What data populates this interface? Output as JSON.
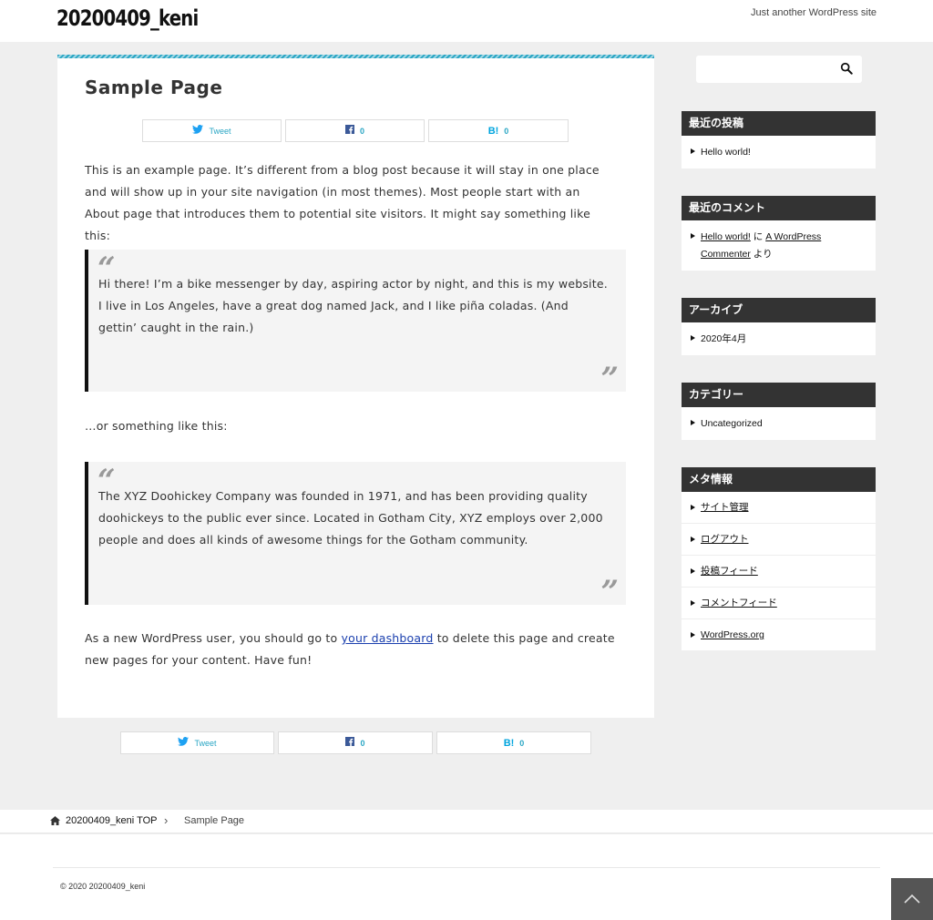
{
  "header": {
    "site_title": "20200409_keni",
    "tagline": "Just another WordPress site"
  },
  "main": {
    "page_title": "Sample Page",
    "share_top": {
      "tweet": "Tweet",
      "facebook_count": "0",
      "hatena_count": "0"
    },
    "intro": "This is an example page. It’s different from a blog post because it will stay in one place and will show up in your site navigation (in most themes). Most people start with an About page that introduces them to potential site visitors. It might say something like this:",
    "quote1": "Hi there! I’m a bike messenger by day, aspiring actor by night, and this is my website. I live in Los Angeles, have a great dog named Jack, and I like piña coladas. (And gettin’ caught in the rain.)",
    "or_text": "…or something like this:",
    "quote2": "The XYZ Doohickey Company was founded in 1971, and has been providing quality doohickeys to the public ever since. Located in Gotham City, XYZ employs over 2,000 people and does all kinds of awesome things for the Gotham community.",
    "outro_before": "As a new WordPress user, you should go to ",
    "outro_link": "your dashboard",
    "outro_after": " to delete this page and create new pages for your content. Have fun!",
    "share_bottom": {
      "tweet": "Tweet",
      "facebook_count": "0",
      "hatena_count": "0"
    }
  },
  "sidebar": {
    "recent_posts": {
      "title": "最近の投稿",
      "items": [
        "Hello world!"
      ]
    },
    "recent_comments": {
      "title": "最近のコメント",
      "post": "Hello world!",
      "ni": "に",
      "author": "A WordPress Commenter",
      "yori": "より"
    },
    "archives": {
      "title": "アーカイブ",
      "items": [
        "2020年4月"
      ]
    },
    "categories": {
      "title": "カテゴリー",
      "items": [
        "Uncategorized"
      ]
    },
    "meta": {
      "title": "メタ情報",
      "items": [
        "サイト管理",
        "ログアウト",
        "投稿フィード",
        "コメントフィード",
        "WordPress.org"
      ]
    }
  },
  "breadcrumb": {
    "home": "20200409_keni TOP",
    "separator": "›",
    "current": "Sample Page"
  },
  "footer": {
    "copyright": "© 2020 20200409_keni"
  },
  "colors": {
    "accent": "#2aa6c4",
    "widget_header": "#333333",
    "link": "#1a3fae"
  }
}
